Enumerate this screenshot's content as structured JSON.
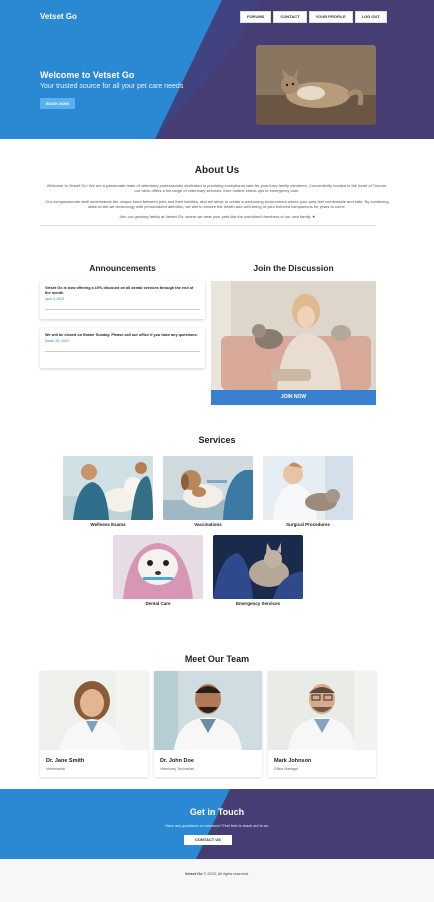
{
  "brand": "Vetset Go",
  "nav": [
    "FORUMS",
    "CONTACT",
    "YOUR PROFILE",
    "LOG OUT"
  ],
  "hero": {
    "title": "Welcome to Vetset Go",
    "subtitle": "Your trusted source for all your pet care needs",
    "button": "BOOK NOW"
  },
  "about": {
    "title": "About Us",
    "p1": "Welcome to Vetset Go! We are a passionate team of veterinary professionals dedicated to providing exceptional care for your furry family members. Conveniently located in the heart of Toronto, our clinic offers a full range of veterinary services, from routine check-ups to emergency care.",
    "p2": "Our compassionate staff understands the unique bond between pets and their families, and we strive to create a welcoming environment where your pets feel comfortable and safe. By combining state-of-the-art technology with personalized attention, we aim to ensure the health and well-being of your beloved companions for years to come.",
    "p3": "Join our growing family at Vetset Go, where we treat your pets like the cherished members of our own family. ♥"
  },
  "announcements": {
    "title": "Announcements",
    "items": [
      {
        "text": "Vetset Go is now offering a 10% discount on all dental services through the end of the month.",
        "date": "April 3, 2023"
      },
      {
        "text": "We will be closed on Easter Sunday. Please call our office if you have any questions.",
        "date": "March 28, 2023"
      }
    ]
  },
  "discussion": {
    "title": "Join the Discussion",
    "button": "JOIN NOW"
  },
  "services": {
    "title": "Services",
    "items": [
      "Wellness Exams",
      "Vaccinations",
      "Surgical Procedures",
      "Dental Care",
      "Emergency Services"
    ]
  },
  "team": {
    "title": "Meet Our Team",
    "members": [
      {
        "name": "Dr. Jane Smith",
        "role": "Veterinarian"
      },
      {
        "name": "Dr. John Doe",
        "role": "Veterinary Technician"
      },
      {
        "name": "Mark Johnson",
        "role": "Office Manager"
      }
    ]
  },
  "contact": {
    "title": "Get in Touch",
    "subtitle": "Have any questions or concerns? Feel free to reach out to us.",
    "button": "CONTACT US"
  },
  "footer": {
    "brand": "Vetset Go",
    "text": "© 2023. All rights reserved."
  },
  "colors": {
    "primary": "#2b89d4",
    "secondary": "#453d74",
    "button": "#3a7fd0"
  }
}
